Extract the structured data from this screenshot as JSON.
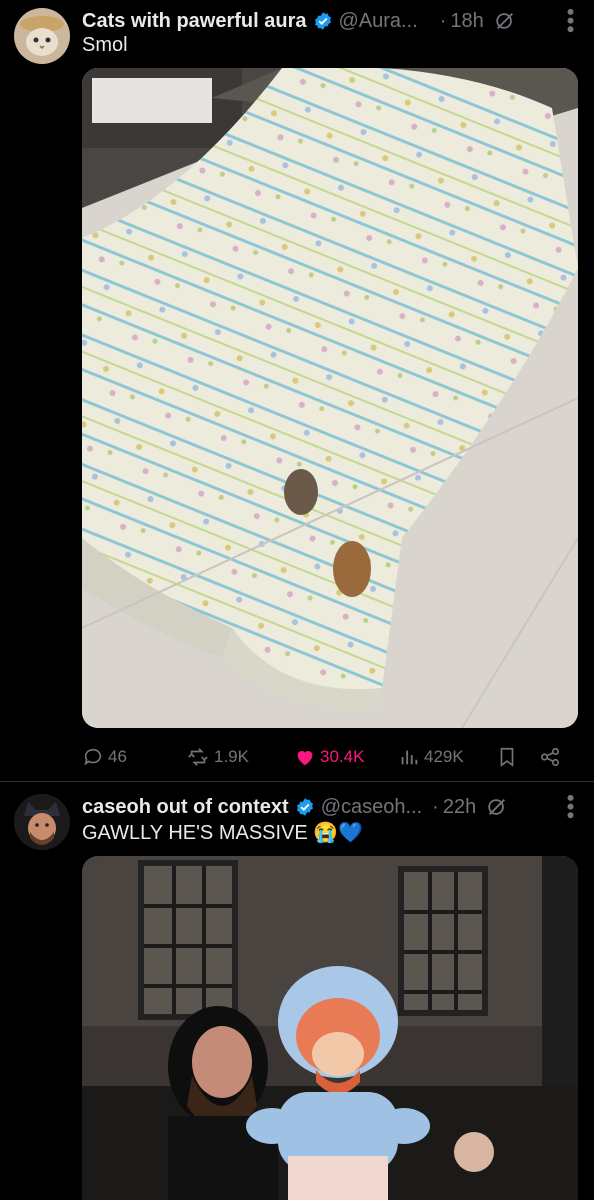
{
  "posts": [
    {
      "account_name": "Cats with pawerful aura",
      "handle": "@Aura...",
      "dot": "·",
      "time": "18h",
      "text": "Smol",
      "stats": {
        "replies": "46",
        "reposts": "1.9K",
        "likes": "30.4K",
        "views": "429K"
      }
    },
    {
      "account_name": "caseoh out of context",
      "handle": "@caseoh...",
      "dot": "·",
      "time": "22h",
      "text": "GAWLLY HE'S MASSIVE",
      "emoji": "😭💙"
    }
  ],
  "colors": {
    "like_active": "#f91880",
    "verified": "#1d9bf0",
    "muted": "#71767b"
  }
}
